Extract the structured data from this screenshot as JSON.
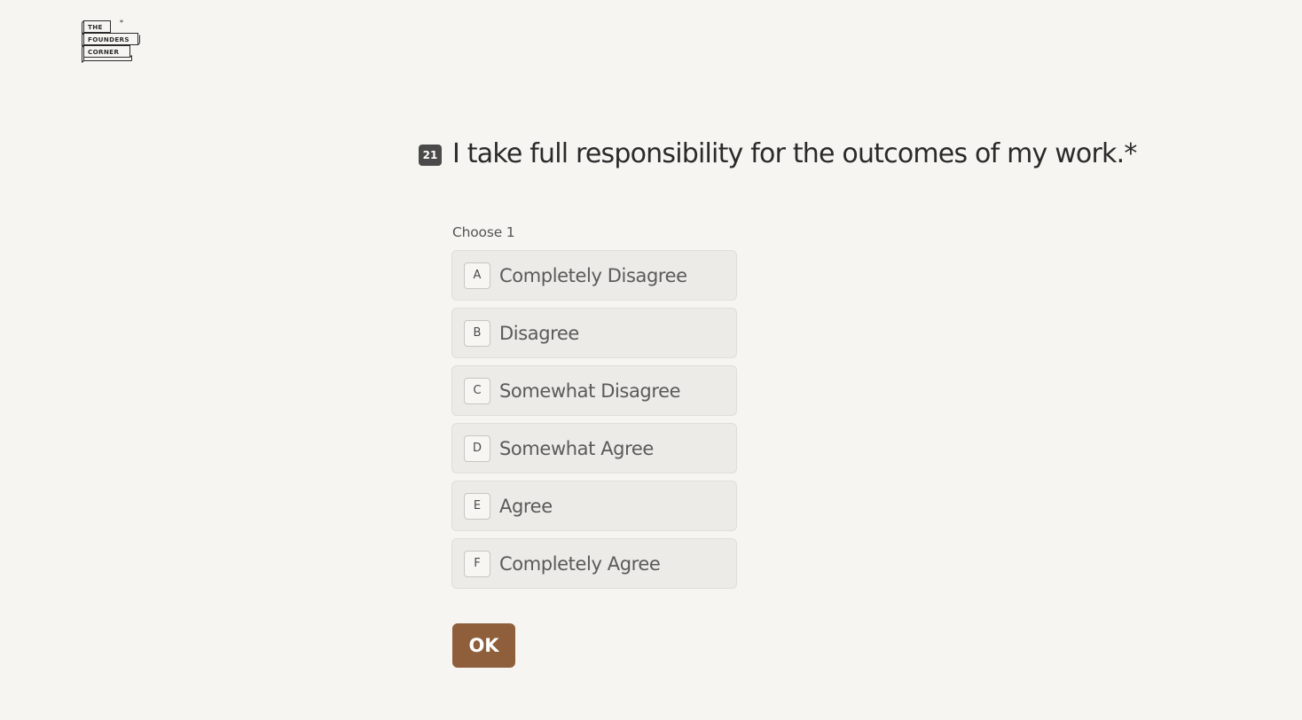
{
  "brand": {
    "logo_lines": [
      "THE",
      "FOUNDERS",
      "CORNER"
    ],
    "logo_mark": "*"
  },
  "question": {
    "number": "21",
    "text": "I take full responsibility for the outcomes of my work.*"
  },
  "choose_label": "Choose 1",
  "options": [
    {
      "key": "A",
      "label": "Completely Disagree"
    },
    {
      "key": "B",
      "label": "Disagree"
    },
    {
      "key": "C",
      "label": "Somewhat Disagree"
    },
    {
      "key": "D",
      "label": "Somewhat Agree"
    },
    {
      "key": "E",
      "label": "Agree"
    },
    {
      "key": "F",
      "label": "Completely Agree"
    }
  ],
  "submit": {
    "label": "OK"
  },
  "colors": {
    "background": "#f7f5f1",
    "option_background": "#ecebe7",
    "accent": "#8e5f3a",
    "question_badge": "#4a4a4a"
  }
}
